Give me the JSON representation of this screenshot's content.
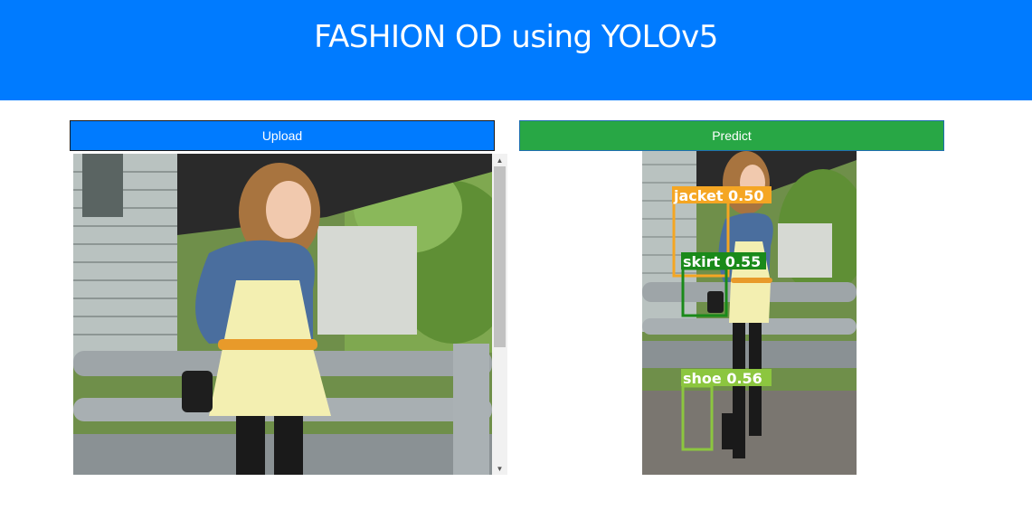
{
  "header": {
    "title": "FASHION OD using YOLOv5"
  },
  "buttons": {
    "upload_label": "Upload",
    "predict_label": "Predict"
  },
  "colors": {
    "header_bg": "#007bff",
    "upload_bg": "#007bff",
    "predict_bg": "#28a745",
    "jacket_box": "#f5a623",
    "skirt_box": "#1a8a1a",
    "shoe_box": "#8cc63f"
  },
  "detections": [
    {
      "label": "jacket 0.50",
      "class": "jacket",
      "confidence": 0.5
    },
    {
      "label": "skirt 0.55",
      "class": "skirt",
      "confidence": 0.55
    },
    {
      "label": "shoe 0.56",
      "class": "shoe",
      "confidence": 0.56
    }
  ]
}
